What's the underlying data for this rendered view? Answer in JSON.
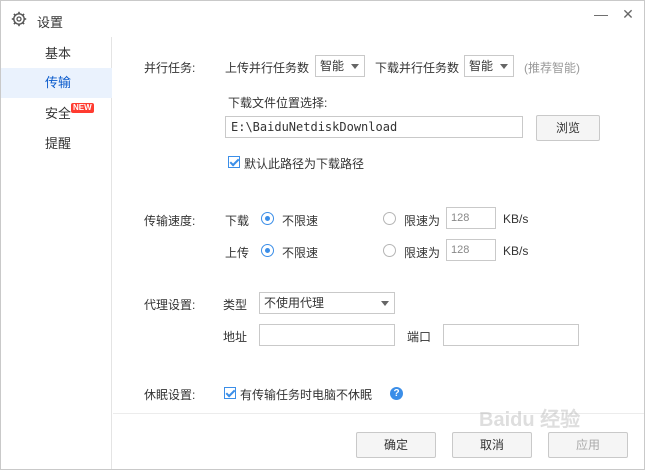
{
  "window": {
    "title": "设置",
    "minimize": "—",
    "close": "✕"
  },
  "sidebar": {
    "items": [
      {
        "label": "基本"
      },
      {
        "label": "传输"
      },
      {
        "label": "安全",
        "badge": "NEW"
      },
      {
        "label": "提醒"
      }
    ]
  },
  "parallel": {
    "section": "并行任务:",
    "upload_label": "上传并行任务数",
    "upload_value": "智能",
    "download_label": "下载并行任务数",
    "download_value": "智能",
    "hint": "(推荐智能)"
  },
  "download_location": {
    "label": "下载文件位置选择:",
    "path": "E:\\BaiduNetdiskDownload",
    "browse": "浏览",
    "default_checkbox": "默认此路径为下载路径"
  },
  "speed": {
    "section": "传输速度:",
    "download": {
      "label": "下载",
      "unlimited": "不限速",
      "limit": "限速为",
      "value": "128",
      "unit": "KB/s"
    },
    "upload": {
      "label": "上传",
      "unlimited": "不限速",
      "limit": "限速为",
      "value": "128",
      "unit": "KB/s"
    }
  },
  "proxy": {
    "section": "代理设置:",
    "type_label": "类型",
    "type_value": "不使用代理",
    "address_label": "地址",
    "address_value": "",
    "port_label": "端口",
    "port_value": ""
  },
  "sleep": {
    "section": "休眠设置:",
    "checkbox": "有传输任务时电脑不休眠",
    "help": "?"
  },
  "footer": {
    "ok": "确定",
    "cancel": "取消",
    "apply": "应用"
  },
  "watermark": "Baidu 经验",
  "colors": {
    "accent": "#3b8ee8",
    "active_bg": "#eaf2fd",
    "badge": "#ff3b30"
  }
}
